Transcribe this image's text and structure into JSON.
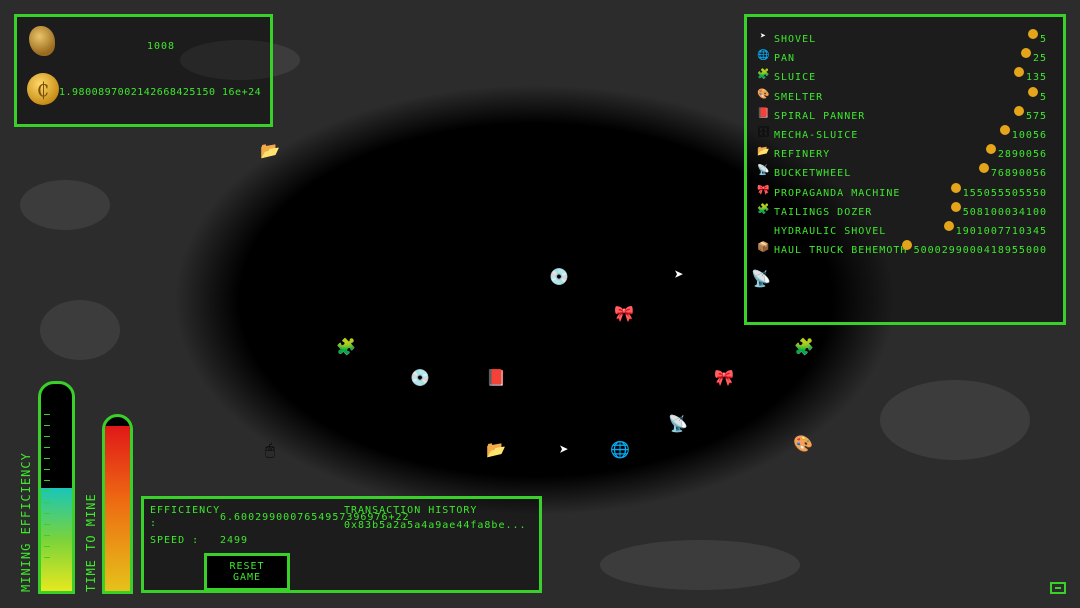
{
  "resources": {
    "gold_nuggets": "1008",
    "coins": "1.9800897002142668425150 16e+24"
  },
  "store": {
    "items": [
      {
        "name": "SHOVEL",
        "price": "5",
        "icon": "cursor-icon"
      },
      {
        "name": "PAN",
        "price": "25",
        "icon": "globe-icon"
      },
      {
        "name": "SLUICE",
        "price": "135",
        "icon": "network-icon"
      },
      {
        "name": "SMELTER",
        "price": "5",
        "icon": "paint-icon"
      },
      {
        "name": "SPIRAL PANNER",
        "price": "575",
        "icon": "book-icon"
      },
      {
        "name": "MECHA-SLUICE",
        "price": "10056",
        "icon": "chip-icon"
      },
      {
        "name": "REFINERY",
        "price": "2890056",
        "icon": "folder-icon"
      },
      {
        "name": "BUCKETWHEEL",
        "price": "76890056",
        "icon": "satellite-icon"
      },
      {
        "name": "PROPAGANDA MACHINE",
        "price": "155055505550",
        "icon": "bow-icon"
      },
      {
        "name": "TAILINGS DOZER",
        "price": "508100034100",
        "icon": "network-icon"
      },
      {
        "name": "HYDRAULIC SHOVEL",
        "price": "1901007710345",
        "icon": "mouse-icon"
      },
      {
        "name": "HAUL TRUCK BEHEMOTH",
        "price": "5000299000418955000",
        "icon": "box-icon"
      }
    ]
  },
  "meters": {
    "mining_efficiency_label": "MINING EFFICIENCY",
    "time_to_mine_label": "TIME TO MINE",
    "mining_efficiency_level": 0.5,
    "time_to_mine_level": 0.95
  },
  "stats": {
    "efficiency_label": "EFFICIENCY",
    "efficiency_colon": ":",
    "efficiency_value": "6.6002990007654957396976+22",
    "speed_label": "SPEED :",
    "speed_value": "2499",
    "history_label": "TRANSACTION HISTORY",
    "history_entry": "0x83b5a2a5a4a9ae44fa8be...",
    "reset_label": "RESET GAME"
  },
  "colors": {
    "accent": "#39d02a",
    "text": "#3ee82d",
    "coin": "#e5a51b"
  }
}
